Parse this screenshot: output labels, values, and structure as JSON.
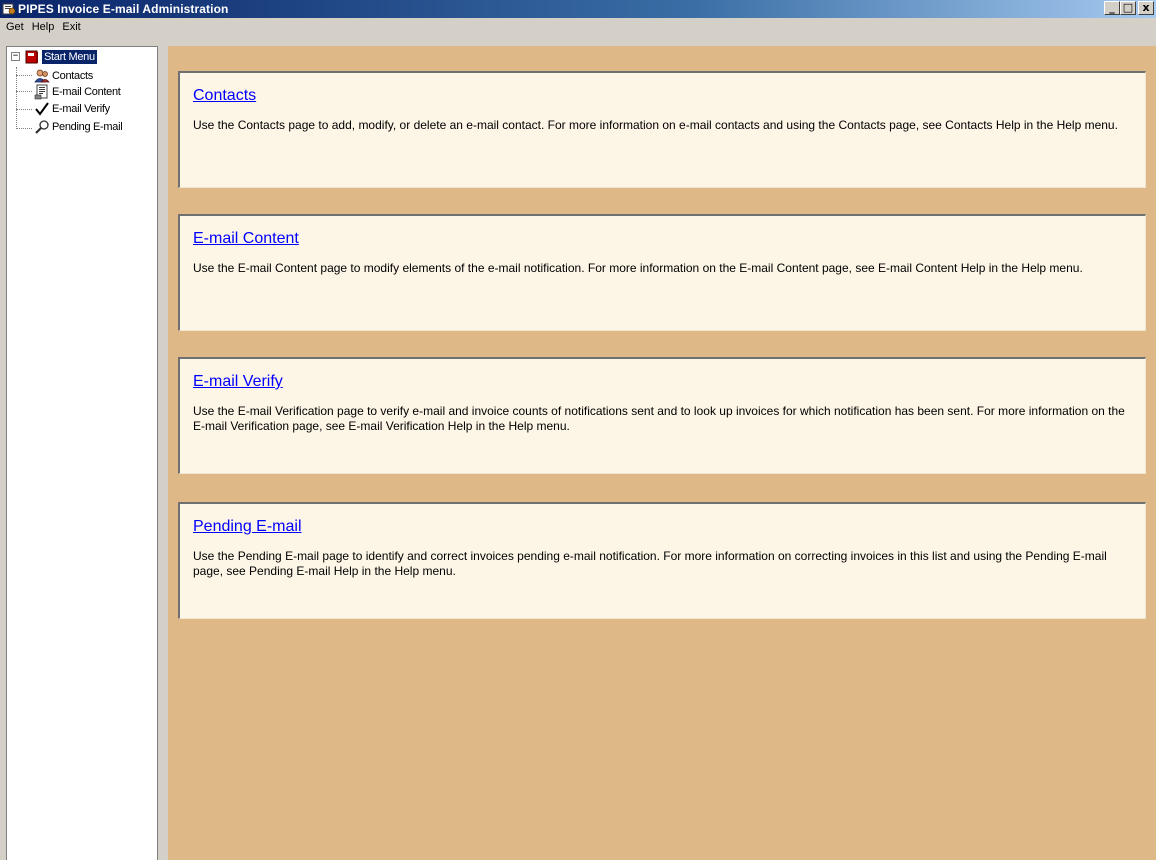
{
  "window": {
    "title": "PIPES Invoice E-mail Administration",
    "controls": {
      "minimize": "_",
      "restore": "□",
      "close": "x"
    }
  },
  "menu": [
    "Get",
    "Help",
    "Exit"
  ],
  "tree": {
    "expander": "−",
    "root": "Start Menu",
    "items": [
      {
        "label": "Contacts",
        "icon": "contacts-icon"
      },
      {
        "label": "E-mail Content",
        "icon": "email-content-icon"
      },
      {
        "label": "E-mail Verify",
        "icon": "checkmark-icon"
      },
      {
        "label": "Pending E-mail",
        "icon": "magnifier-icon"
      }
    ]
  },
  "cards": [
    {
      "link": "Contacts",
      "description": "Use the Contacts page to add, modify, or delete an e-mail contact.  For more information on e-mail contacts and using the Contacts page, see Contacts Help in the Help menu."
    },
    {
      "link": "E-mail Content",
      "description": "Use the E-mail Content page to modify elements of the e-mail notification.  For more information on the E-mail Content page, see E-mail Content Help in the Help menu."
    },
    {
      "link": "E-mail Verify",
      "description": "Use the E-mail Verification page to verify e-mail and invoice counts of notifications sent and to look up invoices for which notification has been sent.  For more information on the E-mail Verification page, see E-mail Verification Help in the Help menu."
    },
    {
      "link": "Pending E-mail",
      "description": "Use the Pending E-mail page to identify and correct invoices pending e-mail notification.  For more information on correcting invoices in this list and using the Pending E-mail page, see Pending E-mail Help in the Help menu."
    }
  ],
  "colors": {
    "titlebar": "#0a246a",
    "content_background": "#deb887",
    "card_background": "#fdf5e6",
    "link": "#0000ff"
  }
}
